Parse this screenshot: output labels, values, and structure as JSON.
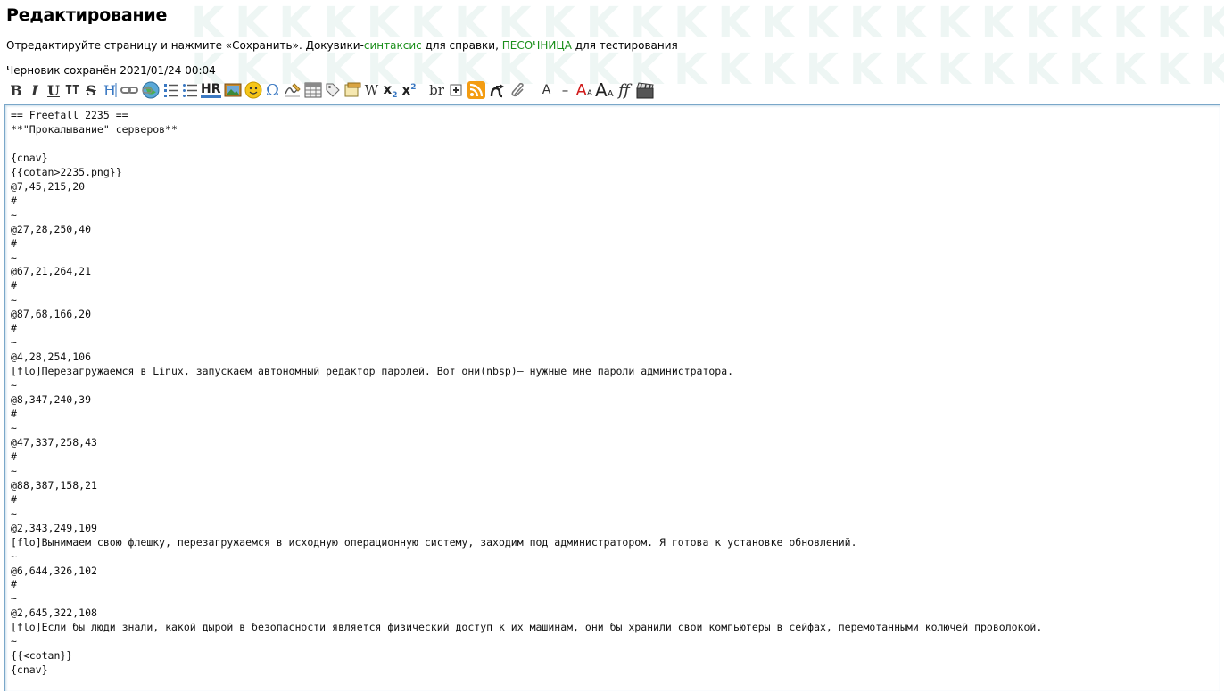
{
  "page": {
    "title": "Редактирование",
    "intro_before": "Отредактируйте страницу и нажмите «Сохранить». Докувики-",
    "syntax_link": "синтаксис",
    "intro_middle": " для справки, ",
    "sandbox_link": "ПЕСОЧНИЦА",
    "intro_after": " для тестирования",
    "draft_status": "Черновик сохранён 2021/01/24 00:04",
    "accent_link_color": "#1a8f1a"
  },
  "toolbar": [
    {
      "icon": "bold-icon",
      "glyph": "B"
    },
    {
      "icon": "italic-icon",
      "glyph": "I"
    },
    {
      "icon": "underline-icon",
      "glyph": "U"
    },
    {
      "icon": "monospace-icon",
      "glyph": "TT"
    },
    {
      "icon": "strikethrough-icon",
      "glyph": "S"
    },
    {
      "icon": "heading-icon",
      "glyph": "H"
    },
    {
      "icon": "internal-link-icon",
      "glyph": "link"
    },
    {
      "icon": "external-link-icon",
      "glyph": "globe"
    },
    {
      "icon": "ordered-list-icon",
      "glyph": "ol"
    },
    {
      "icon": "unordered-list-icon",
      "glyph": "ul"
    },
    {
      "icon": "horizontal-rule-icon",
      "glyph": "HR"
    },
    {
      "icon": "image-icon",
      "glyph": "img"
    },
    {
      "icon": "smiley-icon",
      "glyph": "smile"
    },
    {
      "icon": "special-chars-icon",
      "glyph": "Ω"
    },
    {
      "icon": "signature-icon",
      "glyph": "sig"
    },
    {
      "icon": "table-icon",
      "glyph": "table"
    },
    {
      "icon": "tag-icon",
      "glyph": "tag"
    },
    {
      "icon": "note-icon",
      "glyph": "note"
    },
    {
      "icon": "wikipedia-icon",
      "glyph": "W"
    },
    {
      "icon": "subscript-icon",
      "glyph": "x₂"
    },
    {
      "icon": "superscript-icon",
      "glyph": "x²"
    },
    {
      "icon": "line-break-icon",
      "glyph": "br"
    },
    {
      "icon": "include-icon",
      "glyph": "⊞"
    },
    {
      "icon": "rss-icon",
      "glyph": "rss"
    },
    {
      "icon": "redirect-icon",
      "glyph": "↱"
    },
    {
      "icon": "attachment-icon",
      "glyph": "clip"
    },
    {
      "icon": "small-text-icon",
      "glyph": "A"
    },
    {
      "icon": "dash-icon",
      "glyph": "–"
    },
    {
      "icon": "font-color-icon",
      "glyph": "A"
    },
    {
      "icon": "font-size-icon",
      "glyph": "A"
    },
    {
      "icon": "font-family-icon",
      "glyph": "ff"
    },
    {
      "icon": "media-icon",
      "glyph": "clap"
    }
  ],
  "editor": {
    "lines": [
      "== Freefall 2235 ==",
      "**\"Прокалывание\" серверов**",
      "",
      "{cnav}",
      "{{cotan>2235.png}}",
      "@7,45,215,20",
      "#",
      "~",
      "@27,28,250,40",
      "#",
      "~",
      "@67,21,264,21",
      "#",
      "~",
      "@87,68,166,20",
      "#",
      "~",
      "@4,28,254,106",
      "[flo]Перезагружаемся в Linux, запускаем автономный редактор паролей. Вот они(nbsp)– нужные мне пароли администратора.",
      "~",
      "@8,347,240,39",
      "#",
      "~",
      "@47,337,258,43",
      "#",
      "~",
      "@88,387,158,21",
      "#",
      "~",
      "@2,343,249,109",
      "[flo]Вынимаем свою флешку, перезагружаемся в исходную операционную систему, заходим под администратором. Я готова к установке обновлений.",
      "~",
      "@6,644,326,102",
      "#",
      "~",
      "@2,645,322,108",
      "[flo]Если бы люди знали, какой дырой в безопасности является физический доступ к их машинам, они бы хранили свои компьютеры в сейфах, перемотанными колючей проволокой.",
      "~",
      "{{<cotan}}",
      "{cnav}"
    ]
  }
}
